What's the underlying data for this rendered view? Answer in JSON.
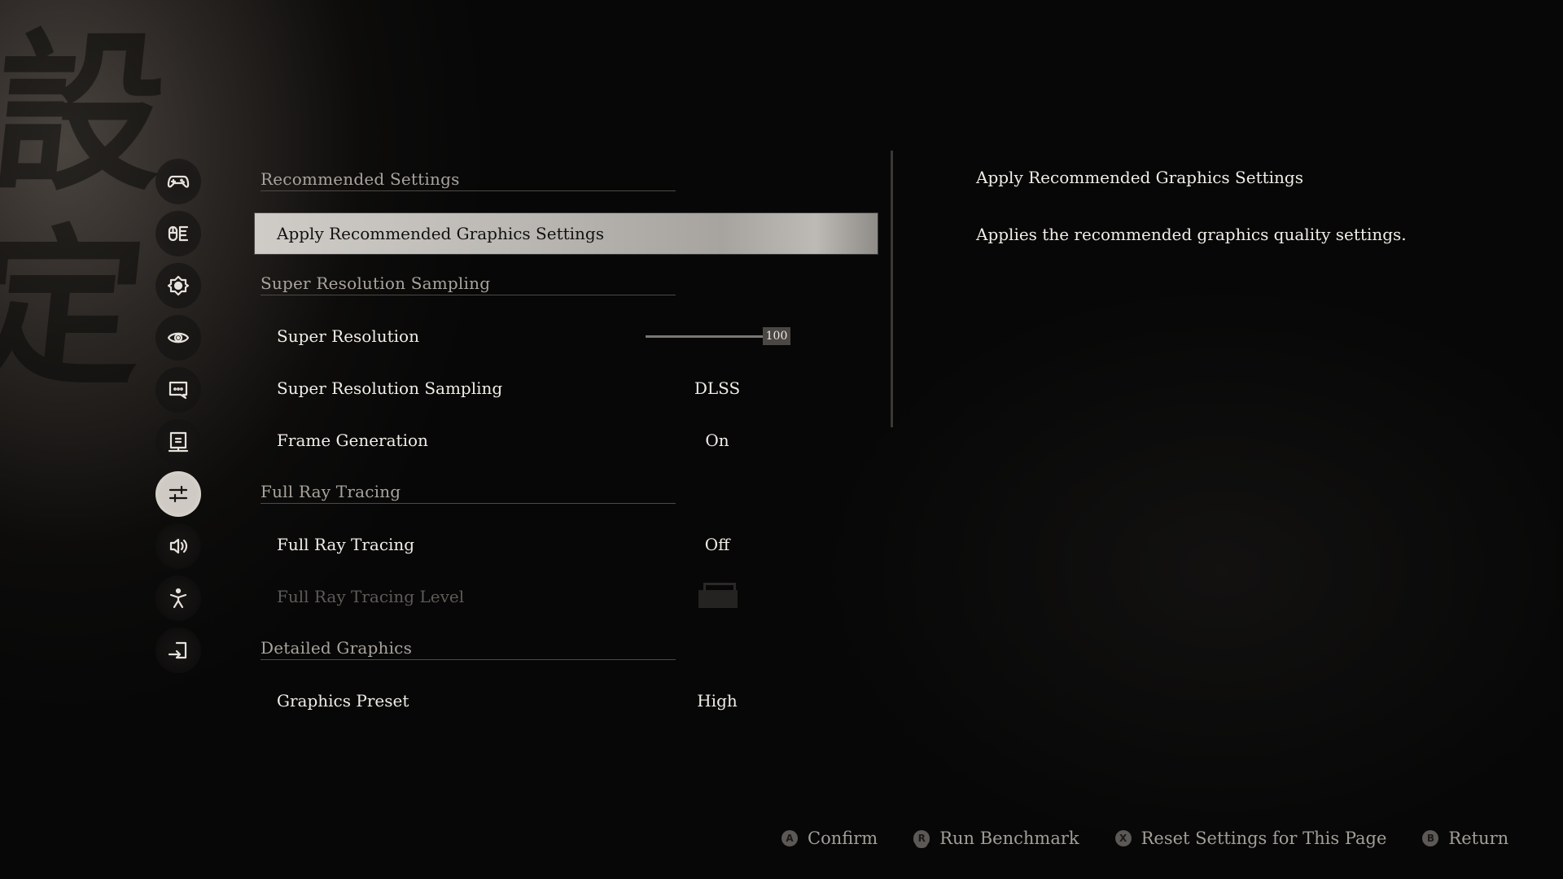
{
  "background": {
    "calligraphy": "設定"
  },
  "sidebar": {
    "items": [
      {
        "name": "controller",
        "icon": "gamepad-icon",
        "active": false
      },
      {
        "name": "mouse-keyboard",
        "icon": "mouse-keyboard-icon",
        "active": false
      },
      {
        "name": "display",
        "icon": "brightness-icon",
        "active": false
      },
      {
        "name": "camera",
        "icon": "eye-icon",
        "active": false
      },
      {
        "name": "language",
        "icon": "chat-bubble-icon",
        "active": false
      },
      {
        "name": "screen",
        "icon": "monitor-icon",
        "active": false
      },
      {
        "name": "graphics",
        "icon": "sliders-icon",
        "active": true
      },
      {
        "name": "audio",
        "icon": "speaker-icon",
        "active": false
      },
      {
        "name": "accessibility",
        "icon": "accessibility-icon",
        "active": false
      },
      {
        "name": "exit",
        "icon": "exit-icon",
        "active": false
      }
    ]
  },
  "settings": {
    "sections": [
      {
        "label": "Recommended Settings"
      },
      {
        "label": "Super Resolution Sampling"
      },
      {
        "label": "Full Ray Tracing"
      },
      {
        "label": "Detailed Graphics"
      }
    ],
    "rows": [
      {
        "label": "Apply Recommended Graphics Settings",
        "value": "",
        "state": "highlighted"
      },
      {
        "label": "Super Resolution",
        "value": "100",
        "slider_value": 100,
        "slider_max": 100
      },
      {
        "label": "Super Resolution Sampling",
        "value": "DLSS"
      },
      {
        "label": "Frame Generation",
        "value": "On"
      },
      {
        "label": "Full Ray Tracing",
        "value": "Off"
      },
      {
        "label": "Full Ray Tracing Level",
        "value": "",
        "state": "locked",
        "icon": "lock-icon"
      },
      {
        "label": "Graphics Preset",
        "value": "High"
      }
    ]
  },
  "description": {
    "title": "Apply Recommended Graphics Settings",
    "body": "Applies the recommended graphics quality settings."
  },
  "footer": {
    "hints": [
      {
        "glyph": "A",
        "label": "Confirm"
      },
      {
        "glyph": "R",
        "label": "Run Benchmark"
      },
      {
        "glyph": "X",
        "label": "Reset Settings for This Page"
      },
      {
        "glyph": "B",
        "label": "Return"
      }
    ]
  }
}
